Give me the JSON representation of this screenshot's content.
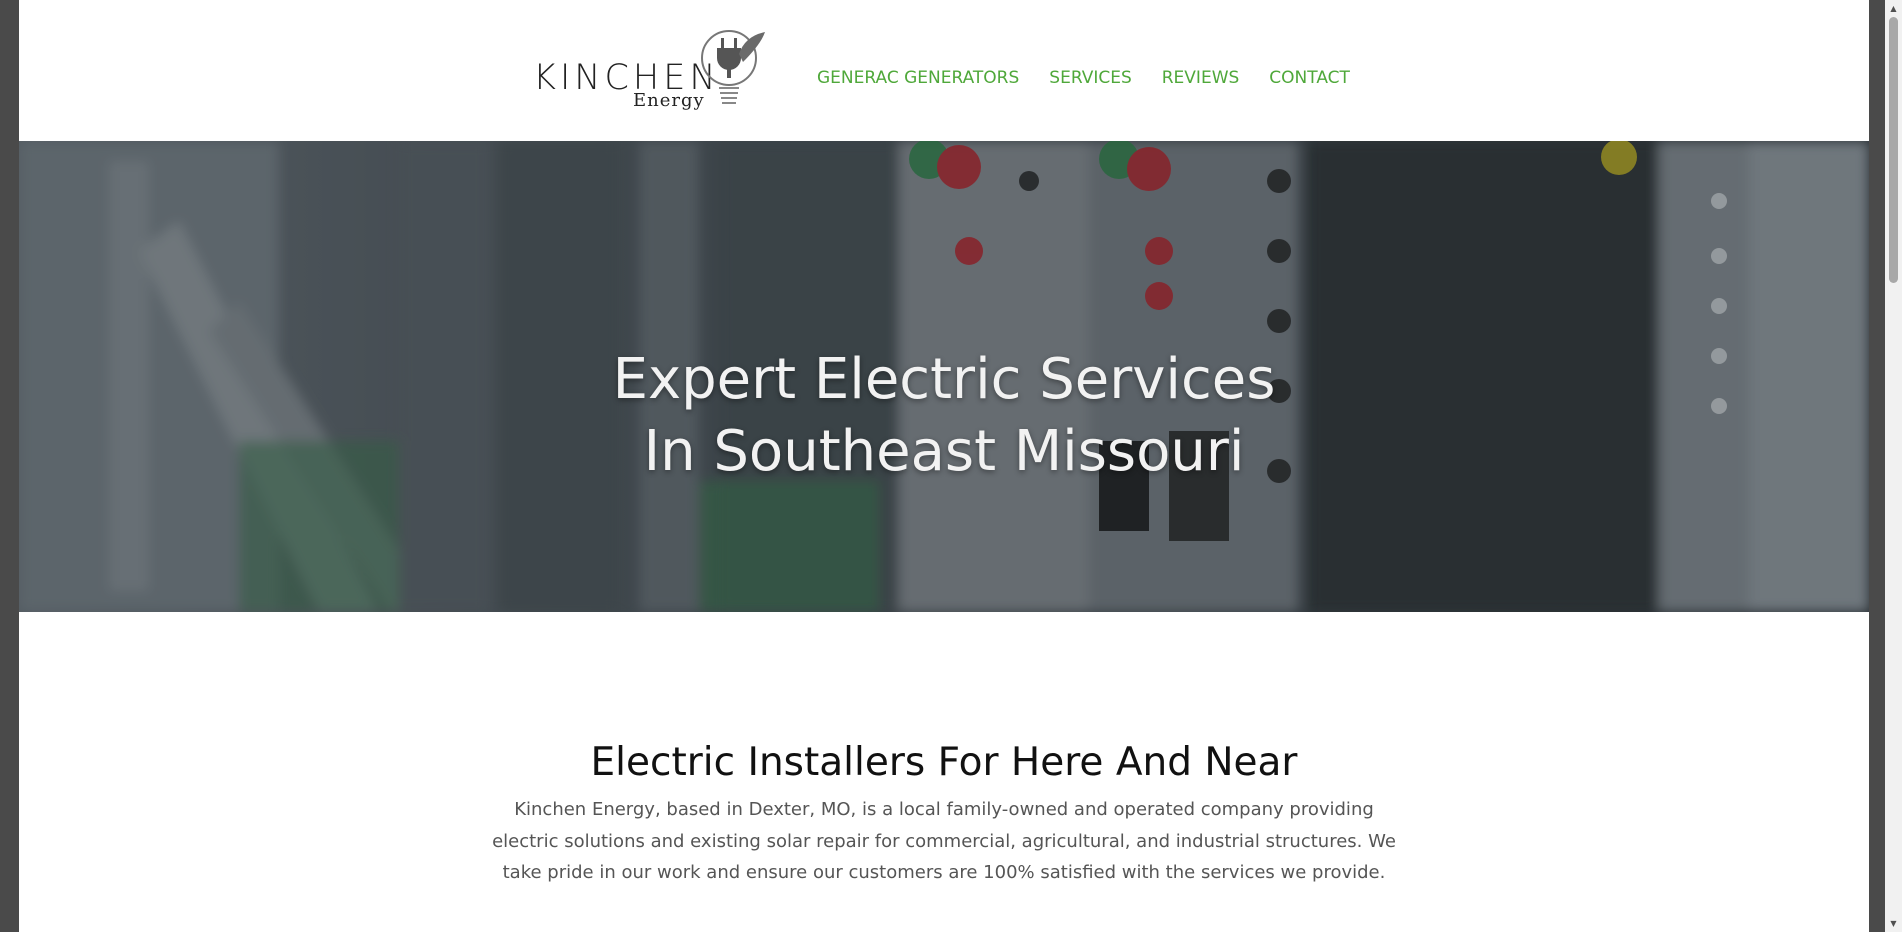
{
  "brand": {
    "logo_name": "KINCHEN",
    "logo_sub": "Energy",
    "icon": "plug-bulb-icon"
  },
  "nav": {
    "items": [
      {
        "label": "GENERAC GENERATORS"
      },
      {
        "label": "SERVICES"
      },
      {
        "label": "REVIEWS"
      },
      {
        "label": "CONTACT"
      }
    ]
  },
  "hero": {
    "title_line1": "Expert Electric Services",
    "title_line2": "In Southeast Missouri"
  },
  "intro": {
    "title": "Electric Installers For Here And Near",
    "body": "Kinchen Energy, based in Dexter, MO, is a local family-owned and operated company providing electric solutions and existing solar repair for commercial, agricultural, and industrial structures. We take pride in our work and ensure our customers are 100% satisfied with the services we provide."
  },
  "scrollbar": {
    "up_icon": "▲",
    "down_icon": "▼"
  },
  "colors": {
    "nav_link": "#4fa83a",
    "hero_overlay": "#3a4045",
    "page_bg": "#ffffff"
  }
}
